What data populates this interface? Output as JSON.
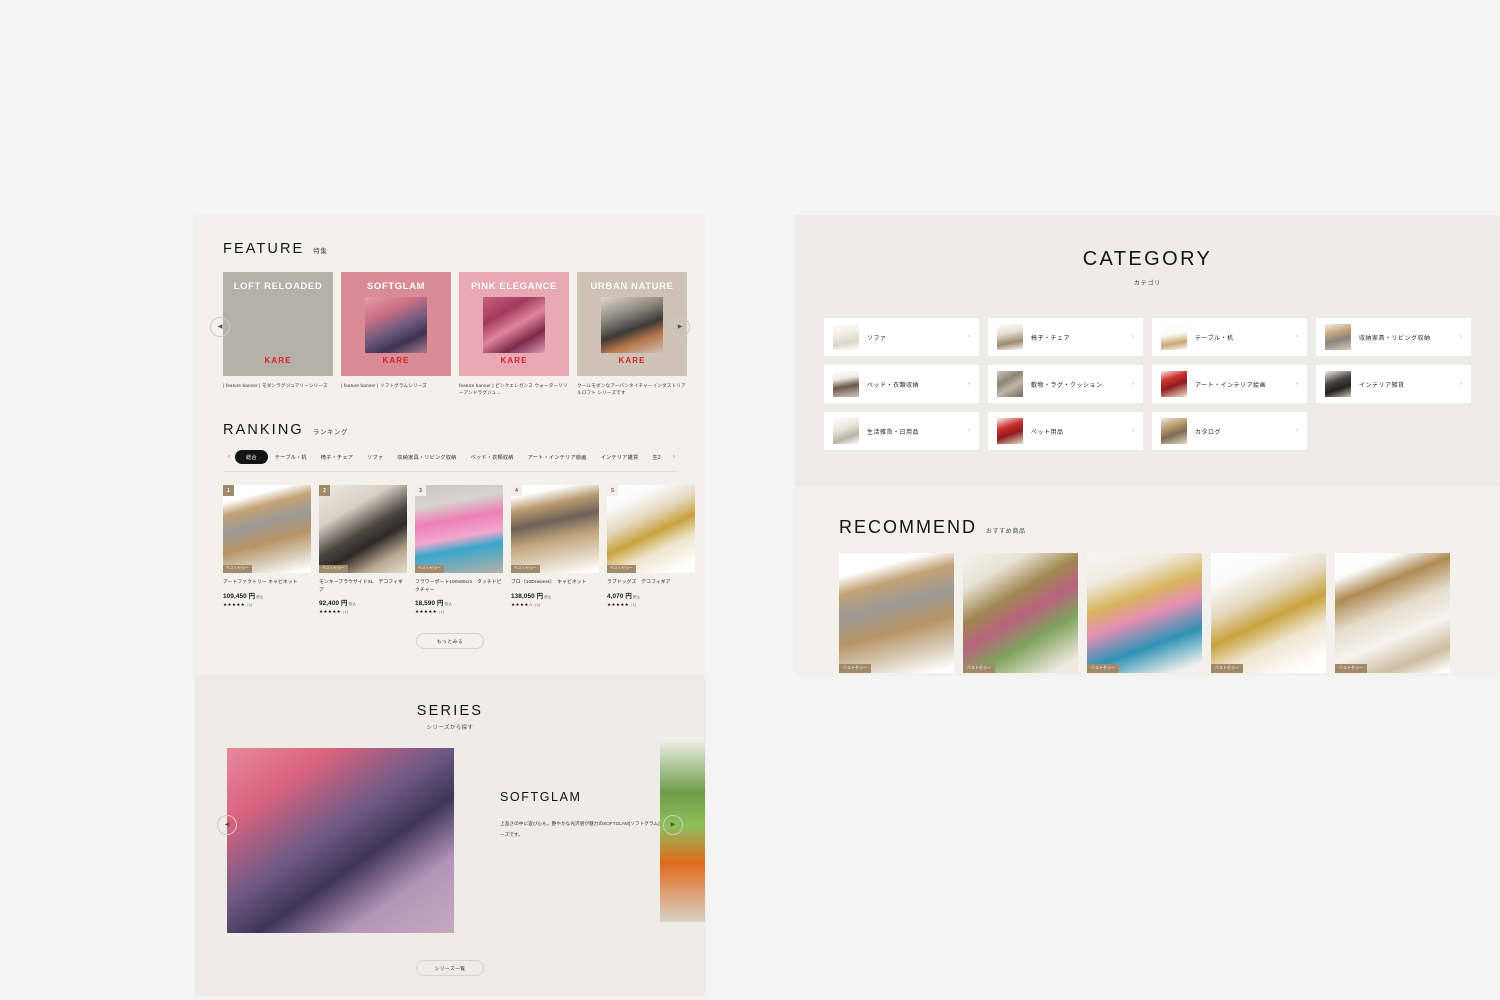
{
  "feature": {
    "heading_en": "FEATURE",
    "heading_jp": "特集",
    "prev_icon": "◀",
    "next_icon": "▶",
    "cards": [
      {
        "title": "LOFT\nRELOADED",
        "brand": "KARE",
        "bg": "#b5b0a8",
        "caption": "| feature banner | モダンラグジュアリーシリーズ"
      },
      {
        "title": "SOFTGLAM",
        "brand": "KARE",
        "bg": "#d98b96",
        "caption": "| feature banner | ソフトグラムシリーズ"
      },
      {
        "title": "PINK\nELEGANCE",
        "brand": "KARE",
        "bg": "#e8a9b4",
        "caption": "feature banner | ピンクエレガンス ウォーターリリーアンドラグジュ…"
      },
      {
        "title": "URBAN\nNATURE",
        "brand": "KARE",
        "bg": "#cdc3b6",
        "caption": "クールモダンなアーバンネイチャーインダストリアルロフト シリーズです"
      }
    ]
  },
  "ranking": {
    "heading_en": "RANKING",
    "heading_jp": "ランキング",
    "prev_icon": "‹",
    "next_icon": "›",
    "tabs": [
      {
        "label": "総合",
        "active": true
      },
      {
        "label": "テーブル・机",
        "active": false
      },
      {
        "label": "椅子・チェア",
        "active": false
      },
      {
        "label": "ソファ",
        "active": false
      },
      {
        "label": "収納家具・リビング収納",
        "active": false
      },
      {
        "label": "ベッド・衣類収納",
        "active": false
      },
      {
        "label": "アート・インテリア絵画",
        "active": false
      },
      {
        "label": "インテリア雑貨",
        "active": false
      },
      {
        "label": "生2",
        "active": false
      }
    ],
    "items": [
      {
        "rank": "1",
        "badge": "ベストセラー",
        "name": "アートファクトリー キャビネット",
        "price": "109,450 円",
        "tax": "税込",
        "stars": "★★★★★",
        "reviews": "(4)",
        "art": "ph-cabinet",
        "badge_light": false
      },
      {
        "rank": "2",
        "badge": "ベストセラー",
        "name": "モンキーブラウサイドXL　デコフィギア",
        "price": "92,400 円",
        "tax": "税込",
        "stars": "★★★★★",
        "reviews": "(1)",
        "art": "ph-gorilla",
        "badge_light": false
      },
      {
        "rank": "3",
        "badge": "ベストセラー",
        "name": "フラワーポート100x80cm　タッチドピクチャー",
        "price": "18,590 円",
        "tax": "税込",
        "stars": "★★★★★",
        "reviews": "(1)",
        "art": "ph-flower",
        "badge_light": true
      },
      {
        "rank": "4",
        "badge": "ベストセラー",
        "name": "ブロ（10Drawers）　キャビネット",
        "price": "138,050 円",
        "tax": "税込",
        "stars": "★★★★☆",
        "reviews": "(2)",
        "art": "ph-bro",
        "badge_light": true
      },
      {
        "rank": "5",
        "badge": "ベストセラー",
        "name": "ラブドッグズ　デコフィギア",
        "price": "4,070 円",
        "tax": "税込",
        "stars": "★★★★★",
        "reviews": "(1)",
        "art": "ph-dog",
        "badge_light": true
      }
    ],
    "more_label": "もっとみる"
  },
  "series": {
    "heading_en": "SERIES",
    "heading_jp": "シリーズから探す",
    "prev_icon": "◀",
    "next_icon": "▶",
    "slide_title": "SOFTGLAM",
    "slide_desc": "上品さの中に遊び心も。艶やかな光沢感が魅力のSOFTGLAM[ソフトグラム]シリーズです。",
    "button_label": "シリーズ一覧"
  },
  "category": {
    "heading_en": "CATEGORY",
    "heading_jp": "カテゴリ",
    "chevron": "›",
    "items": [
      {
        "label": "ソファ",
        "icon": "sofa-icon",
        "art": "ic-sofa"
      },
      {
        "label": "椅子・チェア",
        "icon": "chair-icon",
        "art": "ic-chair"
      },
      {
        "label": "テーブル・机",
        "icon": "table-icon",
        "art": "ic-table"
      },
      {
        "label": "収納家具・リビング収納",
        "icon": "storage-icon",
        "art": "ic-storage"
      },
      {
        "label": "ベッド・衣類収納",
        "icon": "bed-icon",
        "art": "ic-bed"
      },
      {
        "label": "敷物・ラグ・クッション",
        "icon": "rug-icon",
        "art": "ic-rug"
      },
      {
        "label": "アート・インテリア絵画",
        "icon": "art-icon",
        "art": "ic-art"
      },
      {
        "label": "インテリア雑貨",
        "icon": "interior-goods-icon",
        "art": "ic-misc"
      },
      {
        "label": "生活雑貨・日用品",
        "icon": "daily-goods-icon",
        "art": "ic-daily"
      },
      {
        "label": "ペット用品",
        "icon": "pet-icon",
        "art": "ic-pet"
      },
      {
        "label": "カタログ",
        "icon": "catalog-icon",
        "art": "ic-catalog"
      }
    ]
  },
  "recommend": {
    "heading_en": "RECOMMEND",
    "heading_jp": "おすすめ商品",
    "items": [
      {
        "tag": "ベストセラー",
        "art": "ph-cabinet"
      },
      {
        "tag": "ベストセラー",
        "art": "ph-mirror"
      },
      {
        "tag": "ベストセラー",
        "art": "ph-room"
      },
      {
        "tag": "ベストセラー",
        "art": "ph-dog"
      },
      {
        "tag": "ベストセラー",
        "art": "ph-bear"
      }
    ]
  }
}
